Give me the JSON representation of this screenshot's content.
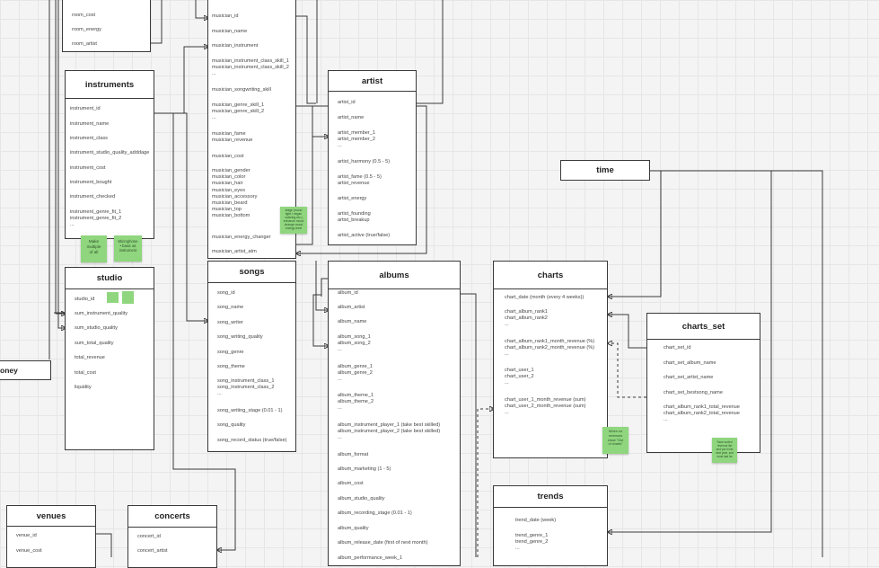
{
  "tables": {
    "room_partial": {
      "title": "",
      "fields": [
        "room_price",
        "room_cost",
        "room_energy",
        "room_artist"
      ]
    },
    "instruments": {
      "title": "instruments",
      "fields": [
        "instrument_id",
        "instrument_name",
        "instrument_class",
        "instrument_studio_quality_adddage",
        "instrument_cost",
        "instrument_bought",
        "instrument_checked",
        "instrument_genre_fit_1\ninstrument_genre_fit_2\n..."
      ]
    },
    "studio": {
      "title": "studio",
      "fields": [
        "studio_id",
        "sum_instrument_quality",
        "sum_studio_quality",
        "sum_total_quality",
        "total_revenue",
        "total_cost",
        "liquidity"
      ]
    },
    "musicians": {
      "title": "",
      "fields": [
        "musician_id",
        "musician_name",
        "musician_instrument",
        "musician_instrument_class_skill_1\nmusician_instrument_class_skill_2\n...",
        "musician_songwriting_skill",
        "musician_genre_skill_1\nmusician_genre_skill_2\n...",
        "musician_fame\nmusician_revenue",
        "musician_cost",
        "musician_gender\nmusician_color\nmusician_hair\nmusician_eyes\nmusician_accessory\nmusician_beard\nmusician_top\nmusician_bottom",
        "musician_energy_changer",
        "musician_artist_atm"
      ]
    },
    "artist": {
      "title": "artist",
      "fields": [
        "artist_id",
        "artist_name",
        "artist_member_1\nartist_member_2\n...",
        "artist_harmony (0.5 - 5)",
        "artist_fame (0.5 - 5)\nartist_revenue",
        "artist_energy",
        "artist_founding\nartist_breakup",
        "artist_active (true/false)"
      ]
    },
    "songs": {
      "title": "songs",
      "fields": [
        "song_id",
        "song_name",
        "song_writer",
        "song_writing_quality",
        "song_genre",
        "song_theme",
        "song_instrument_class_1\nsong_instrument_class_2\n...",
        "song_writing_stage (0.01 - 1)",
        "song_quality",
        "song_record_status (true/false)"
      ]
    },
    "albums": {
      "title": "albums",
      "fields": [
        "album_id",
        "album_artist",
        "album_name",
        "album_song_1\nalbum_song_2\n...",
        "album_genre_1\nalbum_genre_2\n...",
        "album_theme_1\nalbum_theme_2\n...",
        "album_instrument_player_1 (take best skilled)\nalbum_instrument_player_2 (take best skilled)\n...",
        "album_format",
        "album_marketing (1 - 5)",
        "album_cost",
        "album_studio_quality",
        "album_recording_stage (0.01 - 1)",
        "album_quality",
        "album_release_date (first of next month)",
        "album_performance_week_1"
      ]
    },
    "charts": {
      "title": "charts",
      "fields": [
        "chart_date (month (every 4 weeks))",
        "chart_album_rank1\nchart_album_rank2\n...",
        "chart_album_rank1_month_revenue (%)\nchart_album_rank2_month_revenue (%)\n...",
        "chart_user_1\nchart_user_2\n...",
        "chart_user_1_month_revenue (sum)\nchart_user_2_month_revenue (sum)\n..."
      ]
    },
    "charts_set": {
      "title": "charts_set",
      "fields": [
        "chart_set_id",
        "chart_set_album_name",
        "chart_set_artist_name",
        "chart_set_bestsong_name",
        "chart_album_rank1_total_revenue\nchart_album_rank2_total_revenue\n..."
      ]
    },
    "trends": {
      "title": "trends",
      "fields": [
        "trend_date (week)",
        "trend_genre_1\ntrend_genre_2\n..."
      ]
    },
    "venues": {
      "title": "venues",
      "fields": [
        "venue_id",
        "venue_cost"
      ]
    },
    "concerts": {
      "title": "concerts",
      "fields": [
        "concert_id",
        "concert_artist"
      ]
    }
  },
  "labels": {
    "time": "time",
    "money": "oney"
  },
  "stickies": {
    "s1": "Make\nmultiple\nof all",
    "s2": "Microphone\n• basic as\ninstrument",
    "s3": "",
    "s4": "",
    "s5": "stage (mood\nlight / vegan\ncatering etc.)\nenhance mood\nchange mood\nenergy level",
    "s6": "When no\nrevenues\nshow \"Out\nof charts\"",
    "s7": "Save sorted\nrevenue list\nand put in list\nnext year, sort\nmost last for"
  },
  "colors": {
    "sticky": "#8fd67e",
    "line": "#3a3a3a",
    "background": "#f4f4f4"
  }
}
